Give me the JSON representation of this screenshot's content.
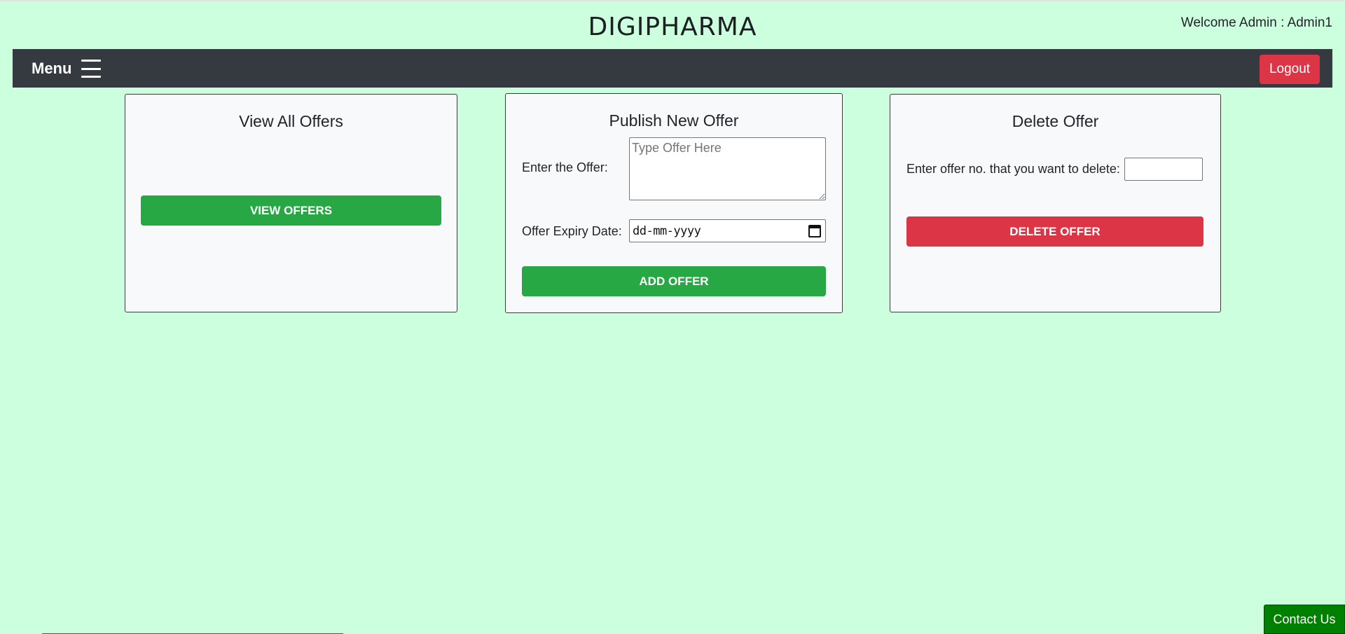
{
  "header": {
    "brand": "DIGIPHARMA",
    "welcome": "Welcome Admin : Admin1"
  },
  "navbar": {
    "menu_label": "Menu",
    "logout_label": "Logout"
  },
  "cards": {
    "view": {
      "title": "View All Offers",
      "button_label": "VIEW OFFERS"
    },
    "publish": {
      "title": "Publish New Offer",
      "offer_label": "Enter the Offer:",
      "offer_placeholder": "Type Offer Here",
      "expiry_label": "Offer Expiry Date:",
      "expiry_value": "dd-mm-yyyy",
      "button_label": "ADD OFFER"
    },
    "delete": {
      "title": "Delete Offer",
      "input_label": "Enter offer no. that you want to delete:",
      "input_value": "",
      "button_label": "DELETE OFFER"
    }
  },
  "footer": {
    "contact_label": "Contact Us"
  },
  "colors": {
    "page_background": "#ccffdd",
    "navbar": "#343a40",
    "success": "#28a745",
    "danger": "#dc3545",
    "contact": "#008000"
  },
  "icons": {
    "menu": "hamburger-icon",
    "date": "calendar-icon"
  }
}
